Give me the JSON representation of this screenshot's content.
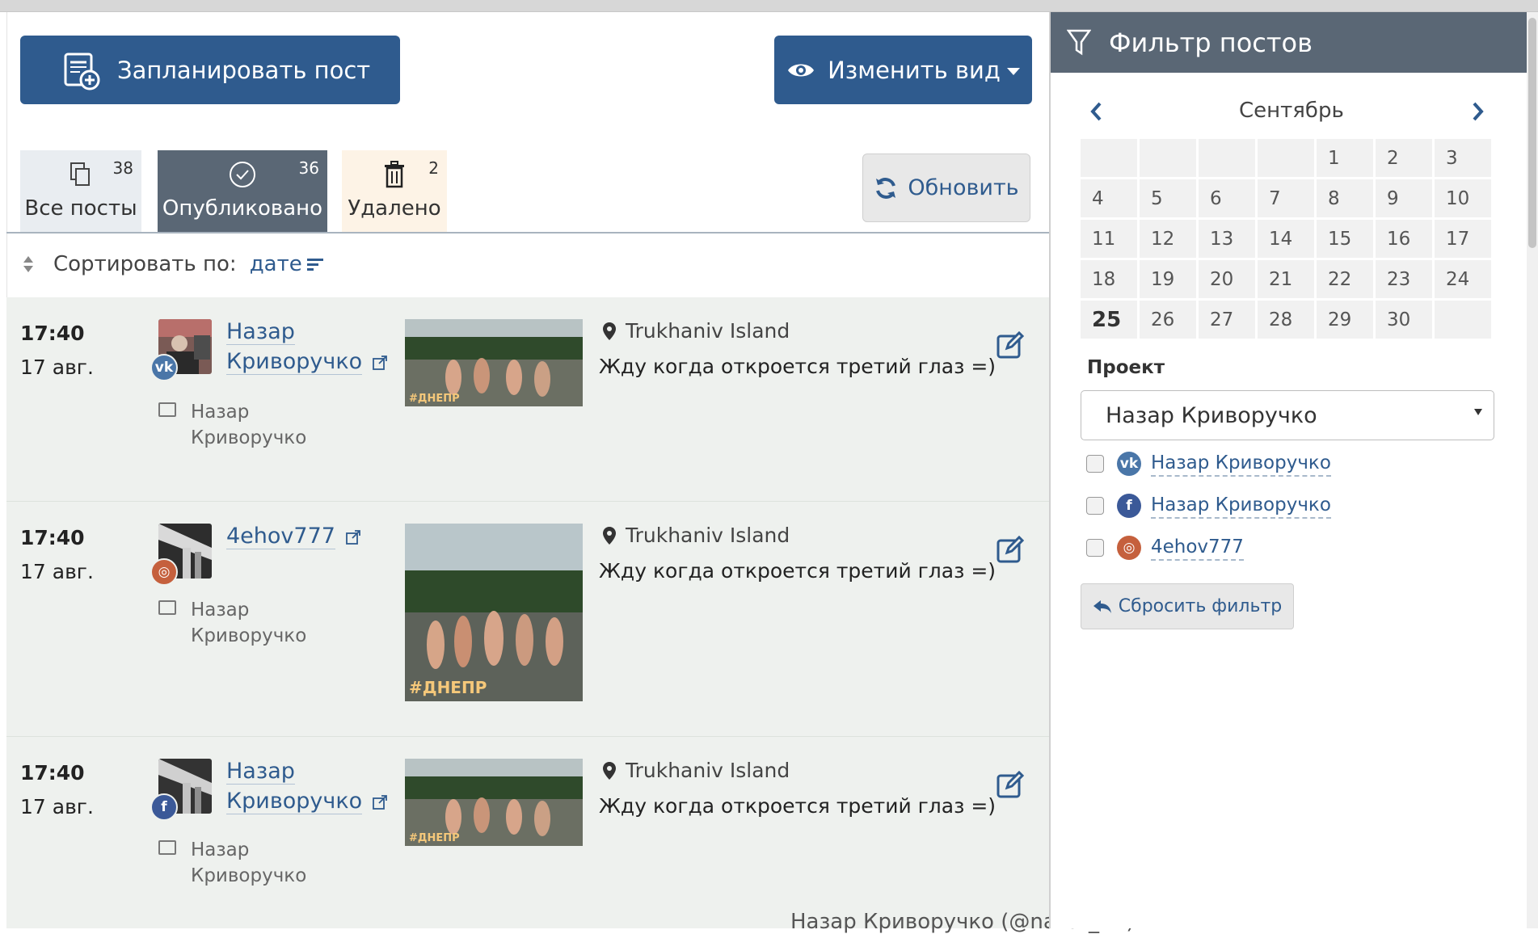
{
  "toolbar": {
    "schedule_label": "Запланировать пост",
    "view_label": "Изменить вид",
    "refresh_label": "Обновить"
  },
  "tabs": [
    {
      "label": "Все посты",
      "count": "38",
      "icon": "copy-icon"
    },
    {
      "label": "Опубликовано",
      "count": "36",
      "icon": "check-circle-icon",
      "active": true
    },
    {
      "label": "Удалено",
      "count": "2",
      "icon": "trash-icon"
    }
  ],
  "sort": {
    "label": "Сортировать по:",
    "value": "дате"
  },
  "posts": [
    {
      "time": "17:40",
      "date": "17 авг.",
      "network": "vk",
      "author": [
        "Назар",
        "Криворучко"
      ],
      "project": [
        "Назар",
        "Криворучко"
      ],
      "location": "Trukhaniv Island",
      "text": "Жду когда откроется третий глаз =)",
      "thumb_caption": "#ДНЕПР"
    },
    {
      "time": "17:40",
      "date": "17 авг.",
      "network": "instagram",
      "author": [
        "4ehov777"
      ],
      "project": [
        "Назар",
        "Криворучко"
      ],
      "location": "Trukhaniv Island",
      "text": "Жду когда откроется третий глаз =)",
      "thumb_caption": "#ДНЕПР"
    },
    {
      "time": "17:40",
      "date": "17 авг.",
      "network": "facebook",
      "author": [
        "Назар",
        "Криворучко"
      ],
      "project": [
        "Назар",
        "Криворучко"
      ],
      "location": "Trukhaniv Island",
      "text": "Жду когда откроется третий глаз =)",
      "thumb_caption": "#ДНЕПР"
    }
  ],
  "footer_note": "Назар Криворучко (@nazar_riv)",
  "sidebar": {
    "title": "Фильтр постов",
    "month": "Сентябрь",
    "calendar_days": [
      "",
      "",
      "",
      "",
      "1",
      "2",
      "3",
      "4",
      "5",
      "6",
      "7",
      "8",
      "9",
      "10",
      "11",
      "12",
      "13",
      "14",
      "15",
      "16",
      "17",
      "18",
      "19",
      "20",
      "21",
      "22",
      "23",
      "24",
      "25",
      "26",
      "27",
      "28",
      "29",
      "30",
      ""
    ],
    "today": "25",
    "project_label": "Проект",
    "project_selected": "Назар Криворучко",
    "accounts": [
      {
        "network": "vk",
        "name": "Назар Криворучко"
      },
      {
        "network": "facebook",
        "name": "Назар Криворучко"
      },
      {
        "network": "instagram",
        "name": "4ehov777"
      }
    ],
    "reset_label": "Сбросить фильтр"
  },
  "colors": {
    "primary": "#2f5b8e",
    "header_gray": "#5a6775",
    "post_bg": "#eef1ee",
    "vk": "#4a76a8",
    "facebook": "#3b5998",
    "instagram": "#c5603d"
  }
}
